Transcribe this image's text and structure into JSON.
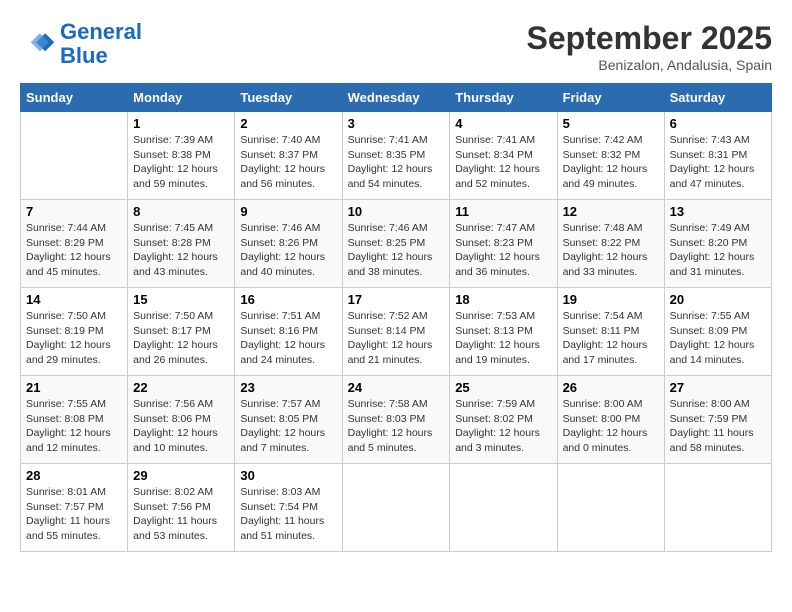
{
  "logo": {
    "line1": "General",
    "line2": "Blue"
  },
  "title": "September 2025",
  "location": "Benizalon, Andalusia, Spain",
  "days_of_week": [
    "Sunday",
    "Monday",
    "Tuesday",
    "Wednesday",
    "Thursday",
    "Friday",
    "Saturday"
  ],
  "weeks": [
    [
      {
        "day": "",
        "info": ""
      },
      {
        "day": "1",
        "info": "Sunrise: 7:39 AM\nSunset: 8:38 PM\nDaylight: 12 hours\nand 59 minutes."
      },
      {
        "day": "2",
        "info": "Sunrise: 7:40 AM\nSunset: 8:37 PM\nDaylight: 12 hours\nand 56 minutes."
      },
      {
        "day": "3",
        "info": "Sunrise: 7:41 AM\nSunset: 8:35 PM\nDaylight: 12 hours\nand 54 minutes."
      },
      {
        "day": "4",
        "info": "Sunrise: 7:41 AM\nSunset: 8:34 PM\nDaylight: 12 hours\nand 52 minutes."
      },
      {
        "day": "5",
        "info": "Sunrise: 7:42 AM\nSunset: 8:32 PM\nDaylight: 12 hours\nand 49 minutes."
      },
      {
        "day": "6",
        "info": "Sunrise: 7:43 AM\nSunset: 8:31 PM\nDaylight: 12 hours\nand 47 minutes."
      }
    ],
    [
      {
        "day": "7",
        "info": "Sunrise: 7:44 AM\nSunset: 8:29 PM\nDaylight: 12 hours\nand 45 minutes."
      },
      {
        "day": "8",
        "info": "Sunrise: 7:45 AM\nSunset: 8:28 PM\nDaylight: 12 hours\nand 43 minutes."
      },
      {
        "day": "9",
        "info": "Sunrise: 7:46 AM\nSunset: 8:26 PM\nDaylight: 12 hours\nand 40 minutes."
      },
      {
        "day": "10",
        "info": "Sunrise: 7:46 AM\nSunset: 8:25 PM\nDaylight: 12 hours\nand 38 minutes."
      },
      {
        "day": "11",
        "info": "Sunrise: 7:47 AM\nSunset: 8:23 PM\nDaylight: 12 hours\nand 36 minutes."
      },
      {
        "day": "12",
        "info": "Sunrise: 7:48 AM\nSunset: 8:22 PM\nDaylight: 12 hours\nand 33 minutes."
      },
      {
        "day": "13",
        "info": "Sunrise: 7:49 AM\nSunset: 8:20 PM\nDaylight: 12 hours\nand 31 minutes."
      }
    ],
    [
      {
        "day": "14",
        "info": "Sunrise: 7:50 AM\nSunset: 8:19 PM\nDaylight: 12 hours\nand 29 minutes."
      },
      {
        "day": "15",
        "info": "Sunrise: 7:50 AM\nSunset: 8:17 PM\nDaylight: 12 hours\nand 26 minutes."
      },
      {
        "day": "16",
        "info": "Sunrise: 7:51 AM\nSunset: 8:16 PM\nDaylight: 12 hours\nand 24 minutes."
      },
      {
        "day": "17",
        "info": "Sunrise: 7:52 AM\nSunset: 8:14 PM\nDaylight: 12 hours\nand 21 minutes."
      },
      {
        "day": "18",
        "info": "Sunrise: 7:53 AM\nSunset: 8:13 PM\nDaylight: 12 hours\nand 19 minutes."
      },
      {
        "day": "19",
        "info": "Sunrise: 7:54 AM\nSunset: 8:11 PM\nDaylight: 12 hours\nand 17 minutes."
      },
      {
        "day": "20",
        "info": "Sunrise: 7:55 AM\nSunset: 8:09 PM\nDaylight: 12 hours\nand 14 minutes."
      }
    ],
    [
      {
        "day": "21",
        "info": "Sunrise: 7:55 AM\nSunset: 8:08 PM\nDaylight: 12 hours\nand 12 minutes."
      },
      {
        "day": "22",
        "info": "Sunrise: 7:56 AM\nSunset: 8:06 PM\nDaylight: 12 hours\nand 10 minutes."
      },
      {
        "day": "23",
        "info": "Sunrise: 7:57 AM\nSunset: 8:05 PM\nDaylight: 12 hours\nand 7 minutes."
      },
      {
        "day": "24",
        "info": "Sunrise: 7:58 AM\nSunset: 8:03 PM\nDaylight: 12 hours\nand 5 minutes."
      },
      {
        "day": "25",
        "info": "Sunrise: 7:59 AM\nSunset: 8:02 PM\nDaylight: 12 hours\nand 3 minutes."
      },
      {
        "day": "26",
        "info": "Sunrise: 8:00 AM\nSunset: 8:00 PM\nDaylight: 12 hours\nand 0 minutes."
      },
      {
        "day": "27",
        "info": "Sunrise: 8:00 AM\nSunset: 7:59 PM\nDaylight: 11 hours\nand 58 minutes."
      }
    ],
    [
      {
        "day": "28",
        "info": "Sunrise: 8:01 AM\nSunset: 7:57 PM\nDaylight: 11 hours\nand 55 minutes."
      },
      {
        "day": "29",
        "info": "Sunrise: 8:02 AM\nSunset: 7:56 PM\nDaylight: 11 hours\nand 53 minutes."
      },
      {
        "day": "30",
        "info": "Sunrise: 8:03 AM\nSunset: 7:54 PM\nDaylight: 11 hours\nand 51 minutes."
      },
      {
        "day": "",
        "info": ""
      },
      {
        "day": "",
        "info": ""
      },
      {
        "day": "",
        "info": ""
      },
      {
        "day": "",
        "info": ""
      }
    ]
  ]
}
